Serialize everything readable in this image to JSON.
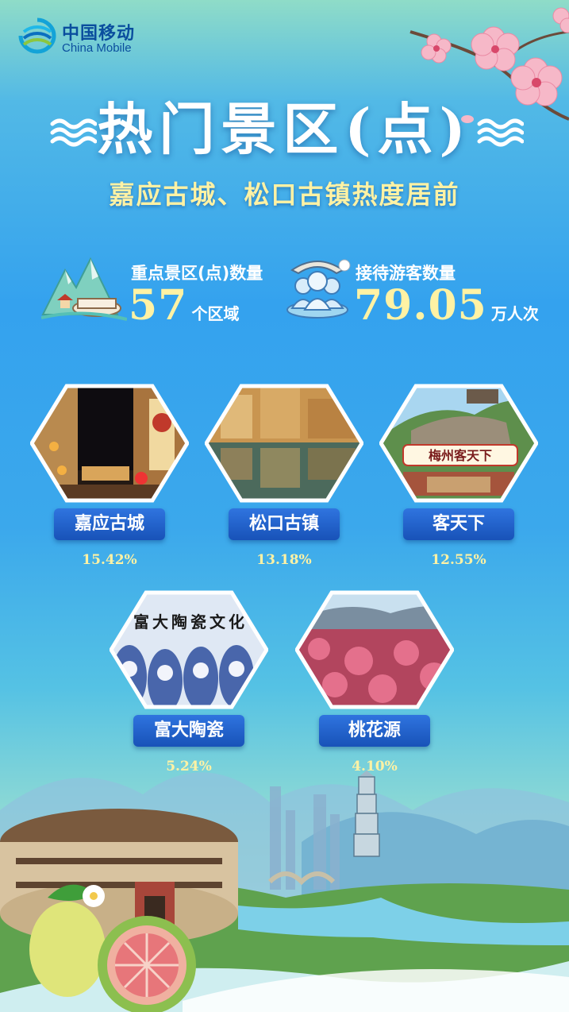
{
  "brand": {
    "name_cn": "中国移动",
    "name_en": "China Mobile"
  },
  "title": "热门景区(点)",
  "subtitle": "嘉应古城、松口古镇热度居前",
  "stats": [
    {
      "label": "重点景区(点)数量",
      "value": "57",
      "unit": "个区域",
      "icon": "mountain-pavilion-icon"
    },
    {
      "label": "接待游客数量",
      "value": "79.05",
      "unit": "万人次",
      "icon": "tourist-group-icon"
    }
  ],
  "spots": [
    {
      "name": "嘉应古城",
      "percent": "15.42%"
    },
    {
      "name": "松口古镇",
      "percent": "13.18%"
    },
    {
      "name": "客天下",
      "percent": "12.55%"
    },
    {
      "name": "富大陶瓷",
      "percent": "5.24%"
    },
    {
      "name": "桃花源",
      "percent": "4.10%"
    }
  ],
  "photo_texts": {
    "keitianxia_sign": "梅州客天下",
    "ceramics_sign": "富大陶瓷文化"
  },
  "colors": {
    "gold": "#fff2a4",
    "button_blue": "#1f5fc9",
    "brand_blue": "#0a4e9e"
  }
}
